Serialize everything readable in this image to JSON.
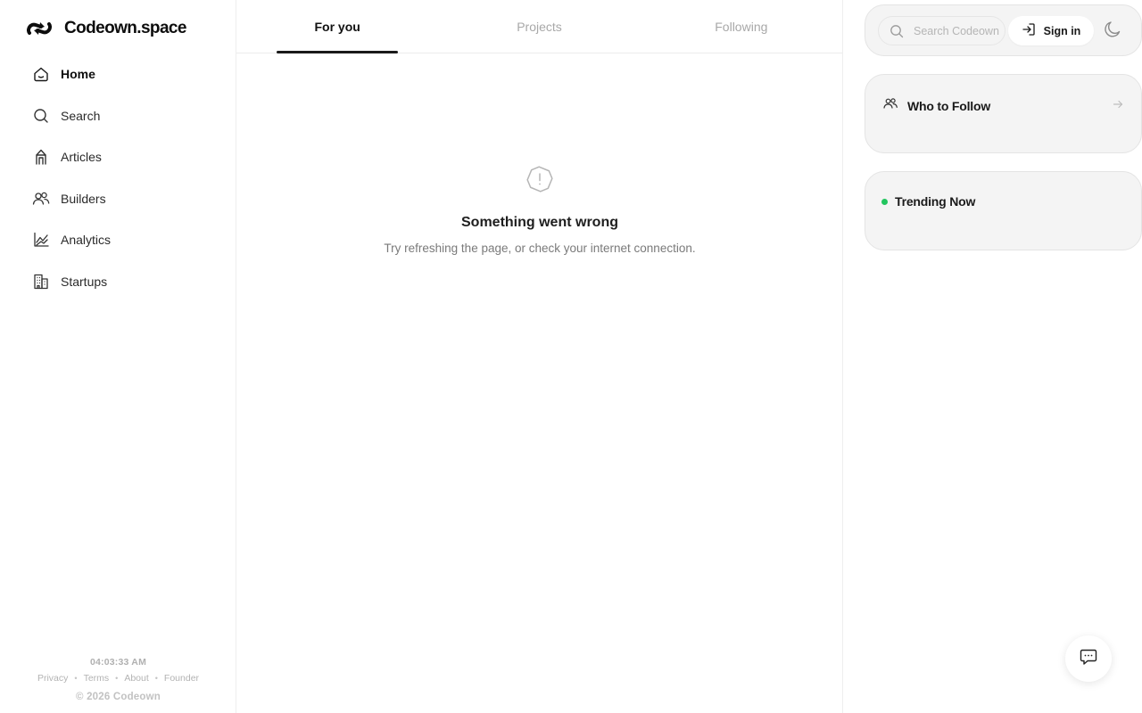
{
  "brand": {
    "name": "Codeown.space",
    "logo_icon": "codeown-logo-icon"
  },
  "nav": {
    "items": [
      {
        "label": "Home",
        "icon": "home-icon",
        "active": true
      },
      {
        "label": "Search",
        "icon": "search-icon"
      },
      {
        "label": "Articles",
        "icon": "articles-icon"
      },
      {
        "label": "Builders",
        "icon": "users-icon"
      },
      {
        "label": "Analytics",
        "icon": "chart-icon"
      },
      {
        "label": "Startups",
        "icon": "building-icon"
      }
    ]
  },
  "footer": {
    "time": "04:03:33 AM",
    "links": [
      "Privacy",
      "Terms",
      "About",
      "Founder"
    ],
    "separator": "•",
    "copyright": "© 2026 Codeown"
  },
  "tabs": [
    {
      "label": "For you",
      "active": true
    },
    {
      "label": "Projects"
    },
    {
      "label": "Following"
    }
  ],
  "error": {
    "icon": "alert-octagon-icon",
    "title": "Something went wrong",
    "message": "Try refreshing the page, or check your internet connection."
  },
  "topbar": {
    "search_placeholder": "Search Codeown",
    "signin_label": "Sign in",
    "theme_icon": "moon-icon"
  },
  "who_to_follow": {
    "title": "Who to Follow",
    "icon": "users-icon",
    "action_icon": "arrow-right-icon"
  },
  "trending": {
    "title": "Trending Now",
    "indicator_color": "#22c55e"
  },
  "chat": {
    "icon": "chat-bubble-icon"
  },
  "colors": {
    "accent": "#1a1a1a",
    "muted": "#a8a8a8",
    "live": "#22c55e"
  }
}
